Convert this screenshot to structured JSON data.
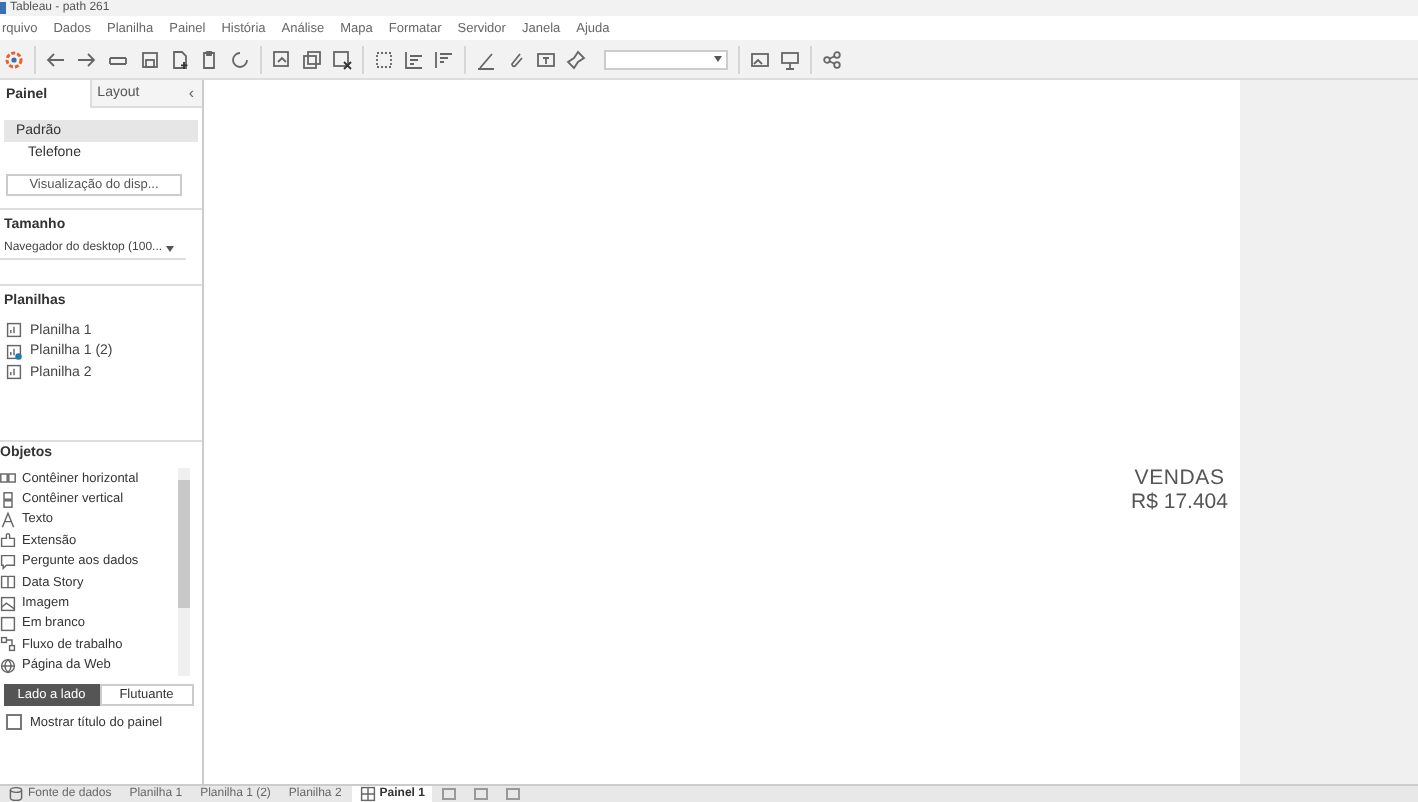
{
  "window": {
    "title": "Tableau - path 261"
  },
  "menu": [
    "rquivo",
    "Dados",
    "Planilha",
    "Painel",
    "História",
    "Análise",
    "Mapa",
    "Formatar",
    "Servidor",
    "Janela",
    "Ajuda"
  ],
  "side_tabs": [
    {
      "label": "Painel",
      "selected": true
    },
    {
      "label": "Layout",
      "selected": false
    }
  ],
  "collapse": "‹",
  "devices": [
    {
      "label": "Padrão",
      "selected": true
    },
    {
      "label": "Telefone",
      "selected": false
    }
  ],
  "device_preview_button": "Visualização do disp...",
  "size": {
    "title": "Tamanho",
    "value": "Navegador do desktop (100..."
  },
  "sheets": {
    "title": "Planilhas",
    "items": [
      {
        "label": "Planilha 1",
        "badge": false
      },
      {
        "label": "Planilha 1 (2)",
        "badge": true
      },
      {
        "label": "Planilha 2",
        "badge": false
      }
    ]
  },
  "objects": {
    "title": "Objetos",
    "items": [
      "Contêiner horizontal",
      "Contêiner vertical",
      "Texto",
      "Extensão",
      "Pergunte aos dados",
      "Data Story",
      "Imagem",
      "Em branco",
      "Fluxo de trabalho",
      "Página da Web"
    ]
  },
  "layout_mode": [
    {
      "label": "Lado a lado",
      "selected": true
    },
    {
      "label": "Flutuante",
      "selected": false
    }
  ],
  "show_title": {
    "label": "Mostrar título do painel",
    "checked": false
  },
  "dashboard": {
    "title": "VENDAS",
    "value": "R$ 17.404"
  },
  "bottom_tabs": [
    {
      "label": "Fonte de dados",
      "kind": "datasource",
      "selected": false
    },
    {
      "label": "Planilha 1",
      "kind": "sheet",
      "selected": false
    },
    {
      "label": "Planilha 1 (2)",
      "kind": "sheet",
      "selected": false
    },
    {
      "label": "Planilha 2",
      "kind": "sheet",
      "selected": false
    },
    {
      "label": "Painel 1",
      "kind": "dashboard",
      "selected": true
    }
  ]
}
